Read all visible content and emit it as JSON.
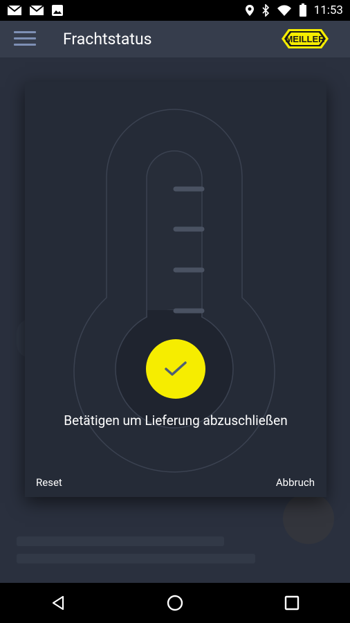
{
  "status_bar": {
    "time": "11:53",
    "left_icons": [
      "mail-icon",
      "mail-icon",
      "image-icon"
    ],
    "right_icons": [
      "location-icon",
      "bluetooth-icon",
      "wifi-icon",
      "battery-icon"
    ]
  },
  "app_bar": {
    "title": "Frachtstatus",
    "logo_text": "MEILLER",
    "menu_icon": "hamburger-menu-icon"
  },
  "dialog": {
    "message": "Betätigen um Lieferung abzuschließen",
    "reset_label": "Reset",
    "cancel_label": "Abbruch",
    "confirm_icon": "check-icon"
  },
  "colors": {
    "accent": "#f6ed00",
    "background": "#2b3140",
    "app_bar": "#363d4c",
    "dialog": "#252b37"
  },
  "nav_bar": {
    "buttons": [
      "back-icon",
      "home-icon",
      "recents-icon"
    ]
  }
}
